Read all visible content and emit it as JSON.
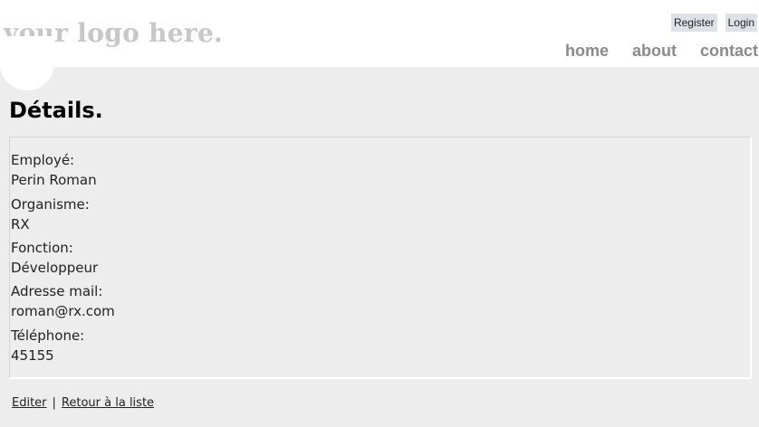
{
  "header": {
    "logo_text": "your logo here.",
    "auth": {
      "register_label": "Register",
      "login_label": "Login"
    },
    "nav": [
      {
        "label": "home"
      },
      {
        "label": "about"
      },
      {
        "label": "contact"
      }
    ]
  },
  "page": {
    "title": "Détails."
  },
  "details": [
    {
      "label": "Employé:",
      "value": "Perin Roman"
    },
    {
      "label": "Organisme:",
      "value": "RX"
    },
    {
      "label": "Fonction:",
      "value": "Développeur"
    },
    {
      "label": "Adresse mail:",
      "value": "roman@rx.com"
    },
    {
      "label": "Téléphone:",
      "value": "45155"
    }
  ],
  "footer": {
    "edit_label": "Editer",
    "separator": "|",
    "back_label": "Retour à la liste"
  },
  "colors": {
    "background": "#ededed",
    "header": "#ffffff",
    "logo": "#c7c7c7",
    "nav": "#8a8a8a",
    "auth_button": "#dde2e6"
  }
}
